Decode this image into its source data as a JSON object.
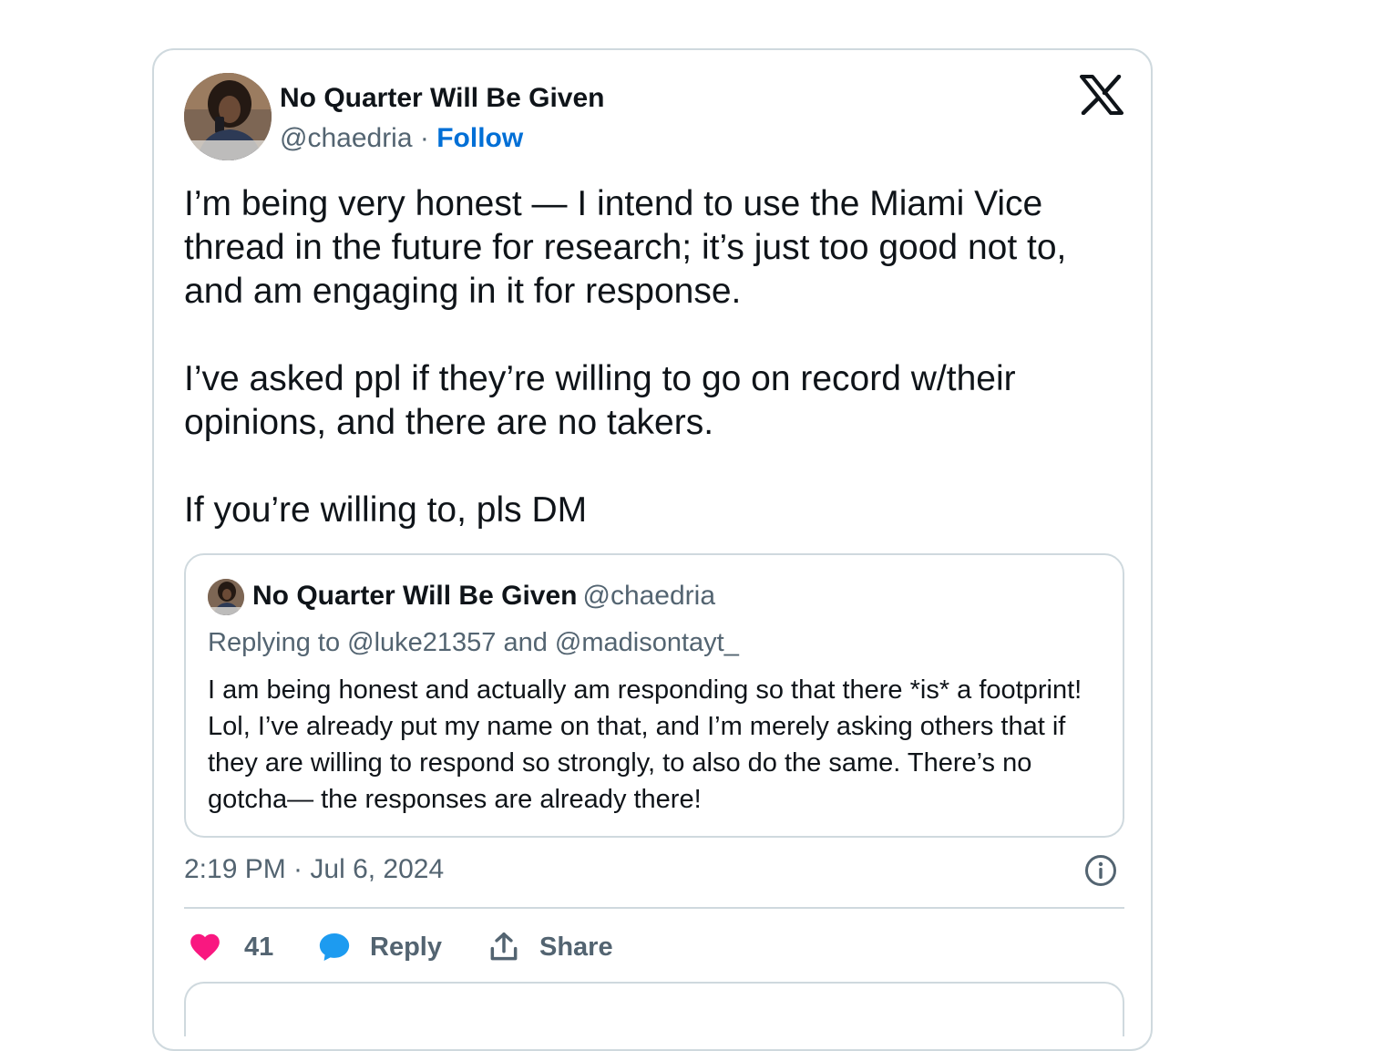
{
  "author": {
    "display_name": "No Quarter Will Be Given",
    "handle": "@chaedria",
    "separator": "·",
    "follow_label": "Follow"
  },
  "tweet": {
    "paragraphs": [
      "I’m being very honest — I intend to use the Miami Vice thread in the future for research; it’s just too good not to, and am engaging in it for response.",
      "I’ve asked ppl if they’re willing to go on record w/their opinions, and there are no takers.",
      "If you’re willing to, pls DM"
    ]
  },
  "quoted": {
    "display_name": "No Quarter Will Be Given",
    "handle": "@chaedria",
    "replying_to": "Replying to @luke21357 and @madisontayt_",
    "text": "I am being honest and actually am responding so that there *is* a footprint! Lol, I’ve already put my name on that, and I’m merely asking others that if they are willing to respond so strongly, to also do the same. There’s no gotcha— the responses are already there!"
  },
  "meta": {
    "timestamp": "2:19 PM · Jul 6, 2024"
  },
  "actions": {
    "like_count": "41",
    "reply_label": "Reply",
    "share_label": "Share"
  },
  "colors": {
    "link": "#006fd6",
    "like": "#f91880",
    "reply_bubble": "#1d9bf0",
    "muted": "#536471",
    "border": "#cfd9de"
  },
  "icons": [
    "x-logo-icon",
    "info-icon",
    "heart-icon",
    "reply-bubble-icon",
    "share-icon"
  ]
}
